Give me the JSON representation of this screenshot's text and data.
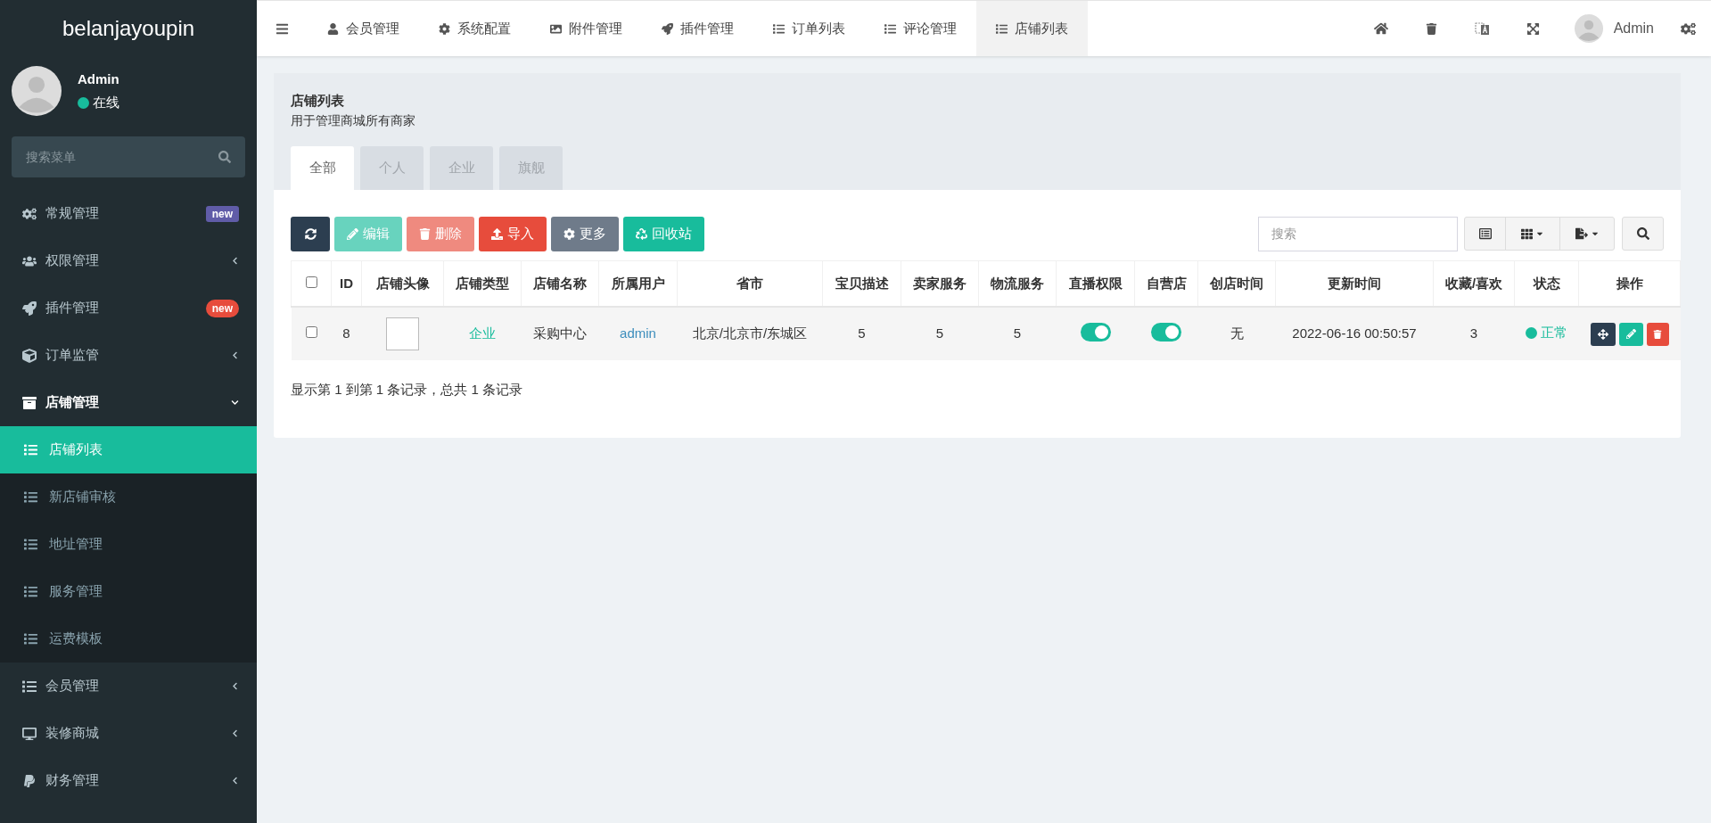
{
  "sidebar": {
    "logo": "belanjayoupin",
    "user": {
      "name": "Admin",
      "status": "在线"
    },
    "search": {
      "placeholder": "搜索菜单"
    },
    "menu": [
      {
        "kind": "badge",
        "label": "常规管理",
        "badge": "new",
        "color": "#605ca8"
      },
      {
        "kind": "group",
        "label": "权限管理",
        "expanded": false
      },
      {
        "kind": "badge",
        "label": "插件管理",
        "badge": "new",
        "color": "#e74c3c"
      },
      {
        "kind": "group",
        "label": "订单监管",
        "expanded": false
      },
      {
        "kind": "group",
        "label": "店铺管理",
        "expanded": true,
        "children": [
          {
            "label": "店铺列表",
            "selected": true
          },
          {
            "label": "新店铺审核",
            "selected": false
          },
          {
            "label": "地址管理",
            "selected": false
          },
          {
            "label": "服务管理",
            "selected": false
          },
          {
            "label": "运费模板",
            "selected": false
          }
        ]
      },
      {
        "kind": "group",
        "label": "会员管理",
        "expanded": false
      },
      {
        "kind": "group",
        "label": "装修商城",
        "expanded": false
      },
      {
        "kind": "group",
        "label": "财务管理",
        "expanded": false
      }
    ]
  },
  "topbar": {
    "tabs": [
      {
        "label": "会员管理",
        "selected": false
      },
      {
        "label": "系统配置",
        "selected": false
      },
      {
        "label": "附件管理",
        "selected": false
      },
      {
        "label": "插件管理",
        "selected": false
      },
      {
        "label": "订单列表",
        "selected": false
      },
      {
        "label": "评论管理",
        "selected": false
      },
      {
        "label": "店铺列表",
        "selected": true
      }
    ],
    "user": "Admin"
  },
  "page": {
    "title": "店铺列表",
    "subtitle": "用于管理商城所有商家",
    "tabs": [
      {
        "label": "全部",
        "selected": true
      },
      {
        "label": "个人",
        "selected": false
      },
      {
        "label": "企业",
        "selected": false
      },
      {
        "label": "旗舰",
        "selected": false
      }
    ]
  },
  "toolbar": {
    "buttons": [
      {
        "kind": "refresh",
        "disabled": false
      },
      {
        "kind": "edit",
        "label": "编辑",
        "disabled": true
      },
      {
        "kind": "delete",
        "label": "删除",
        "disabled": true
      },
      {
        "kind": "import",
        "label": "导入",
        "disabled": false
      },
      {
        "kind": "more",
        "label": "更多",
        "disabled": false
      },
      {
        "kind": "recycle",
        "label": "回收站",
        "disabled": false
      }
    ],
    "search": {
      "placeholder": "搜索"
    }
  },
  "table": {
    "select_all_checked": false,
    "columns": [
      "ID",
      "店铺头像",
      "店铺类型",
      "店铺名称",
      "所属用户",
      "省市",
      "宝贝描述",
      "卖家服务",
      "物流服务",
      "直播权限",
      "自营店",
      "创店时间",
      "更新时间",
      "收藏/喜欢",
      "状态",
      "操作"
    ],
    "rows": [
      {
        "checked": false,
        "id": "8",
        "type": "企业",
        "name": "采购中心",
        "user": "admin",
        "region": "北京/北京市/东城区",
        "desc": "5",
        "seller": "5",
        "logistics": "5",
        "live": true,
        "self_operated": true,
        "created": "无",
        "updated": "2022-06-16 00:50:57",
        "favorites": "3",
        "status": "正常"
      }
    ]
  },
  "pagination": "显示第 1 到第 1 条记录，总共 1 条记录"
}
